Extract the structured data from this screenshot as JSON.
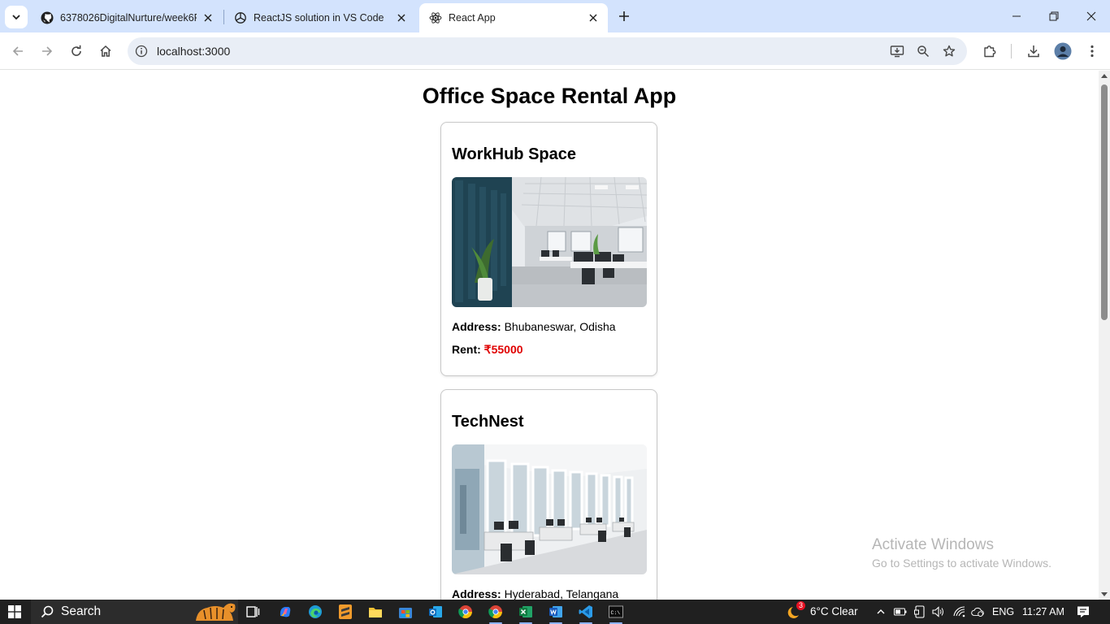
{
  "browser": {
    "tabs": [
      {
        "title": "6378026DigitalNurture/week6R",
        "icon": "github-icon"
      },
      {
        "title": "ReactJS solution in VS Code",
        "icon": "chatgpt-icon"
      },
      {
        "title": "React App",
        "icon": "react-icon"
      }
    ],
    "active_tab": 2,
    "url": "localhost:3000"
  },
  "page": {
    "title": "Office Space Rental App",
    "offices": [
      {
        "name": "WorkHub Space",
        "address_label": "Address:",
        "address": "Bhubaneswar, Odisha",
        "rent_label": "Rent:",
        "rent": "₹55000",
        "rent_color": "#e00000"
      },
      {
        "name": "TechNest",
        "address_label": "Address:",
        "address": "Hyderabad, Telangana"
      }
    ],
    "watermark": {
      "line1": "Activate Windows",
      "line2": "Go to Settings to activate Windows."
    }
  },
  "taskbar": {
    "search_label": "Search",
    "weather_badge": "3",
    "weather": "6°C  Clear",
    "language": "ENG",
    "time": "11:27 AM"
  },
  "colors": {
    "tabstrip": "#d3e3fd",
    "omnibox": "#e9eef6",
    "taskbar": "#202020"
  }
}
